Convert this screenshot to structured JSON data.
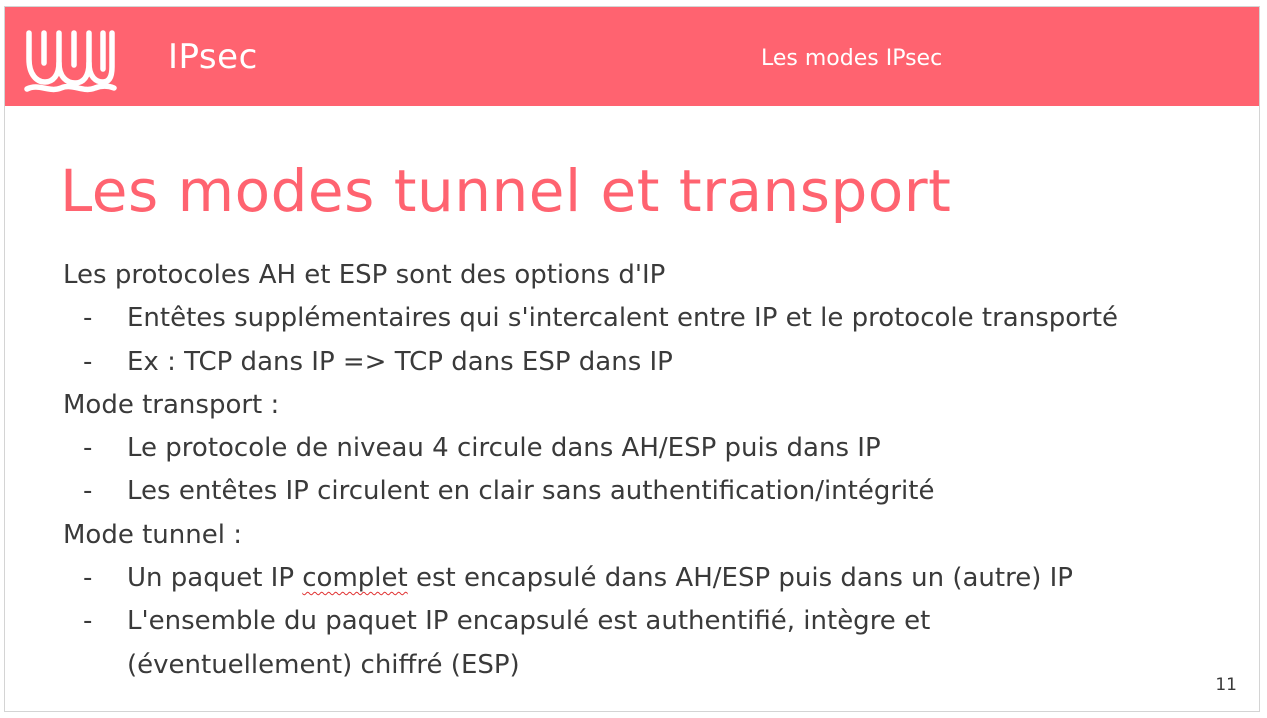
{
  "header": {
    "brand": "IPsec",
    "section": "Les modes IPsec",
    "logo_icon": "wavy-hand-logo-icon",
    "color": "#ff6370"
  },
  "slide": {
    "title": "Les modes tunnel et transport",
    "title_color": "#ff6370",
    "blocks": [
      {
        "heading": "Les protocoles AH et ESP sont des options d'IP",
        "items": [
          "Entêtes supplémentaires qui s'intercalent entre IP et le protocole transporté",
          "Ex : TCP dans IP => TCP dans ESP dans IP"
        ]
      },
      {
        "heading": "Mode transport :",
        "items": [
          "Le protocole de niveau 4 circule dans AH/ESP puis dans IP",
          "Les entêtes IP circulent en clair sans authentification/intégrité"
        ]
      },
      {
        "heading": "Mode tunnel :",
        "items": [
          {
            "before": "Un paquet IP ",
            "underlined": "complet",
            "after": " est encapsulé dans AH/ESP puis dans un (autre) IP"
          },
          "L'ensemble du paquet IP encapsulé est authentifié, intègre et (éventuellement) chiffré (ESP)"
        ]
      }
    ],
    "bullet": "-",
    "page_number": "11"
  }
}
